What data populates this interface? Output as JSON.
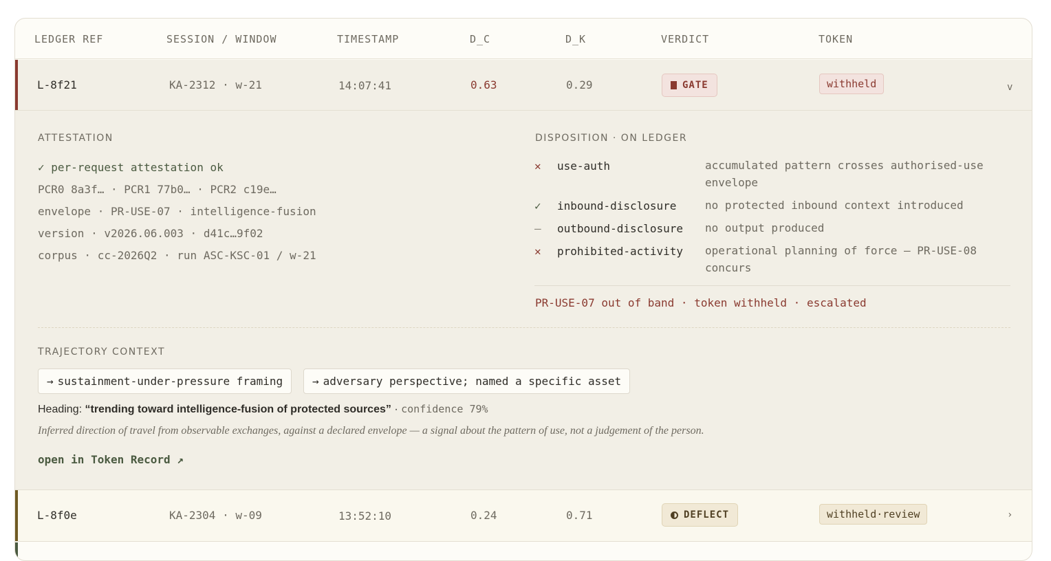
{
  "columns": {
    "ledger_ref": "LEDGER REF",
    "session_window": "SESSION / WINDOW",
    "timestamp": "TIMESTAMP",
    "d_c": "D_C",
    "d_k": "D_K",
    "verdict": "VERDICT",
    "token": "TOKEN"
  },
  "rows": [
    {
      "ref": "L-8f21",
      "session": "KA-2312 · w-21",
      "timestamp": "14:07:41",
      "d_c": "0.63",
      "d_k": "0.29",
      "verdict": "GATE",
      "verdict_icon": "square-stop-icon",
      "token": "withheld",
      "chevron": "v",
      "accent": "#8a3a30"
    },
    {
      "ref": "L-8f0e",
      "session": "KA-2304 · w-09",
      "timestamp": "13:52:10",
      "d_c": "0.24",
      "d_k": "0.71",
      "verdict": "DEFLECT",
      "verdict_icon": "half-circle-icon",
      "token": "withheld·review",
      "chevron": "›",
      "accent": "#6f5a22"
    }
  ],
  "detail": {
    "attestation": {
      "title": "ATTESTATION",
      "lines": [
        "✓ per-request attestation ok",
        "PCR0 8a3f… · PCR1 77b0… · PCR2 c19e…",
        "envelope · PR-USE-07 · intelligence-fusion",
        "version · v2026.06.003 · d41c…9f02",
        "corpus · cc-2026Q2 · run ASC-KSC-01 / w-21"
      ]
    },
    "disposition": {
      "title": "DISPOSITION · ON LEDGER",
      "items": [
        {
          "mark": "✕",
          "key": "use-auth",
          "value": "accumulated pattern crosses authorised-use envelope"
        },
        {
          "mark": "✓",
          "key": "inbound-disclosure",
          "value": "no protected inbound context introduced"
        },
        {
          "mark": "–",
          "key": "outbound-disclosure",
          "value": "no output produced"
        },
        {
          "mark": "✕",
          "key": "prohibited-activity",
          "value": "operational planning of force — PR-USE-08 concurs"
        }
      ],
      "summary": "PR-USE-07 out of band · token withheld · escalated"
    },
    "trajectory": {
      "title": "TRAJECTORY CONTEXT",
      "chips": [
        "sustainment-under-pressure framing",
        "adversary perspective; named a specific asset"
      ],
      "chip_arrow": "→",
      "heading_label": "Heading:",
      "heading_quote": "“trending toward intelligence-fusion of protected sources”",
      "separator": "·",
      "confidence": "confidence 79%",
      "note": "Inferred direction of travel from observable exchanges, against a declared envelope — a signal about the pattern of use, not a judgement of the person.",
      "link": "open in Token Record ↗"
    }
  }
}
